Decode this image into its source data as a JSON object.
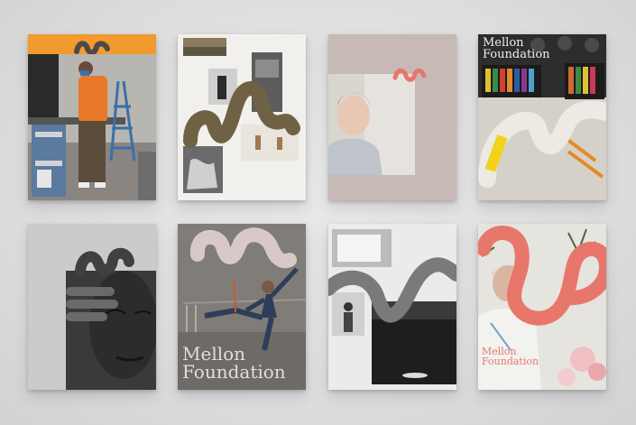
{
  "brand": {
    "line1": "Mellon",
    "line2": "Foundation"
  },
  "colors": {
    "background": "#dcdcdc",
    "accent_orange": "#f29a2e",
    "accent_coral": "#e8776b",
    "accent_olive": "#6f6244",
    "paper_white": "#f1f0ec",
    "taupe": "#c6b9b6"
  },
  "covers": [
    {
      "name": "worker-in-studio",
      "motif": "squiggle-mark"
    },
    {
      "name": "photo-collage",
      "motif": "olive-squiggle"
    },
    {
      "name": "portrait-pink-hair",
      "motif": "coral-squiggle"
    },
    {
      "name": "art-supplies",
      "motif": "white-squiggle"
    },
    {
      "name": "face-closeup",
      "motif": "dark-squiggle"
    },
    {
      "name": "dancer-at-barre",
      "motif": "mauve-squiggle"
    },
    {
      "name": "gallery-space",
      "motif": "gray-squiggle"
    },
    {
      "name": "man-with-flowers",
      "motif": "coral-squiggle"
    }
  ]
}
